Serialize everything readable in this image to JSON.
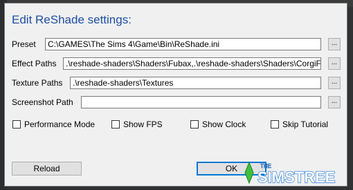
{
  "dialog": {
    "title": "Edit ReShade settings:"
  },
  "preset": {
    "label": "Preset",
    "value": "C:\\GAMES\\The Sims 4\\Game\\Bin\\ReShade.ini",
    "browse": "..."
  },
  "effect_paths": {
    "label": "Effect Paths",
    "value": ".\\reshade-shaders\\Shaders\\Fubax,.\\reshade-shaders\\Shaders\\CorgiFX",
    "browse": "..."
  },
  "texture_paths": {
    "label": "Texture Paths",
    "value": ".\\reshade-shaders\\Textures",
    "browse": "..."
  },
  "screenshot_path": {
    "label": "Screenshot Path",
    "value": "",
    "browse": "..."
  },
  "options": [
    {
      "label": "Performance Mode",
      "checked": false
    },
    {
      "label": "Show FPS",
      "checked": false
    },
    {
      "label": "Show Clock",
      "checked": false
    },
    {
      "label": "Skip Tutorial",
      "checked": false
    }
  ],
  "buttons": {
    "reload": "Reload",
    "ok": "OK"
  },
  "watermark": {
    "small": "THE",
    "brand": "SIMSTREE",
    "color": "#2e7fd8"
  }
}
